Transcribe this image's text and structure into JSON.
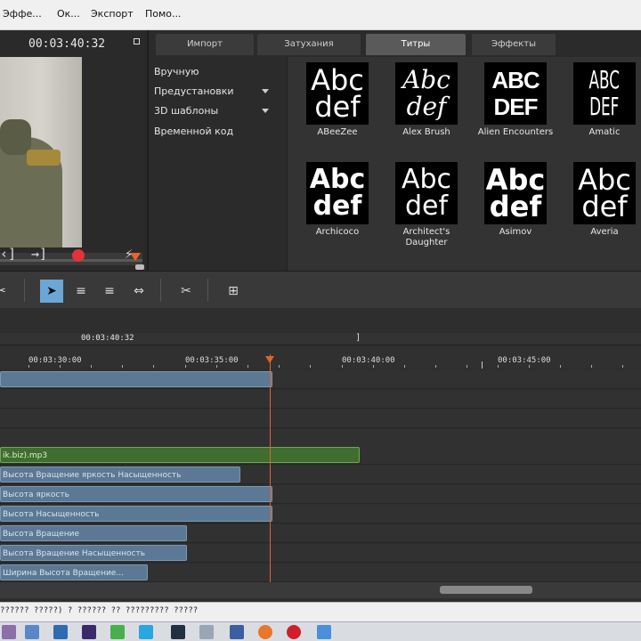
{
  "menu": [
    "Эффе...",
    "Ок...",
    "Экспорт",
    "Помо..."
  ],
  "preview": {
    "timecode": "00:03:40:32"
  },
  "transport": {
    "prev": "‹]",
    "next": "→]",
    "flash": "⚡"
  },
  "tabs": [
    {
      "label": "Импорт",
      "active": false
    },
    {
      "label": "Затухания",
      "active": false
    },
    {
      "label": "Титры",
      "active": true
    },
    {
      "label": "Эффекты",
      "active": false
    }
  ],
  "sidebar": [
    "Вручную",
    "Предустановки",
    "3D шаблоны",
    "Временной код"
  ],
  "titles": [
    {
      "name": "ABeeZee",
      "l1": "Abc",
      "l2": "def"
    },
    {
      "name": "Alex Brush",
      "l1": "Abc",
      "l2": "def"
    },
    {
      "name": "Alien Encounters",
      "l1": "ABC",
      "l2": "DEF"
    },
    {
      "name": "Amatic",
      "l1": "ABC",
      "l2": "DEF"
    },
    {
      "name": "Archicoco",
      "l1": "Abc",
      "l2": "def"
    },
    {
      "name": "Architect's Daughter",
      "l1": "Abc",
      "l2": "def"
    },
    {
      "name": "Asimov",
      "l1": "Abc",
      "l2": "def"
    },
    {
      "name": "Averia",
      "l1": "Abc",
      "l2": "def"
    }
  ],
  "timeline": {
    "top_timecode": "00:03:40:32",
    "bracket": "]",
    "ruler": [
      "00:03:30:00",
      "00:03:35:00",
      "00:03:40:00",
      "00:03:45:00"
    ],
    "clips": [
      {
        "label": ""
      },
      {
        "label": "ik.biz).mp3"
      },
      {
        "label": "Высота  Вращение  яркость  Насыщенность"
      },
      {
        "label": "Высота  яркость"
      },
      {
        "label": "Высота  Насыщенность"
      },
      {
        "label": "Высота  Вращение"
      },
      {
        "label": "Высота  Вращение  Насыщенность"
      },
      {
        "label": "Ширина  Высота  Вращение..."
      }
    ]
  },
  "status": "?????? ?????) ? ?????? ?? ????????? ?????",
  "colors": {
    "accent": "#e0642c",
    "clip_blue": "#5b7894",
    "clip_green": "#3f6e2f",
    "record": "#e0333a",
    "tool_active": "#6aa7d6"
  }
}
